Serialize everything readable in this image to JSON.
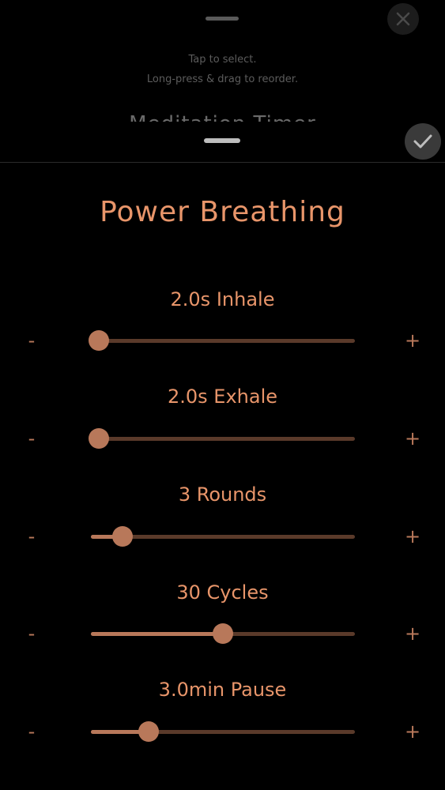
{
  "background": {
    "hint_line1": "Tap to select.",
    "hint_line2": "Long-press & drag to reorder.",
    "clipped_title": "Meditation Timer"
  },
  "sheet": {
    "title": "Power Breathing"
  },
  "controls": {
    "minus": "-",
    "plus": "+"
  },
  "settings": [
    {
      "label": "2.0s Inhale",
      "level": 0.03
    },
    {
      "label": "2.0s Exhale",
      "level": 0.03
    },
    {
      "label": "3 Rounds",
      "level": 0.12
    },
    {
      "label": "30 Cycles",
      "level": 0.5
    },
    {
      "label": "3.0min Pause",
      "level": 0.22
    }
  ],
  "colors": {
    "accent": "#e8956a",
    "slider_fill": "#b8785a",
    "slider_track": "#5a3a2a",
    "background": "#000000"
  },
  "icons": {
    "close": "close-icon",
    "confirm": "checkmark-icon"
  }
}
